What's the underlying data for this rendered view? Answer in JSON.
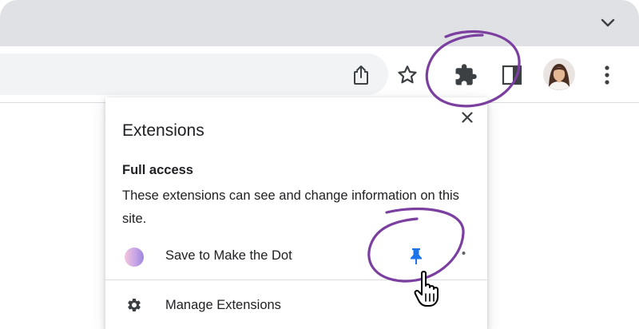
{
  "colors": {
    "tabstrip": "#dfe1e5",
    "text": "#202124",
    "icon": "#5f6368",
    "pin": "#1a73e8",
    "annotation": "#7b3fa0"
  },
  "tabstrip": {
    "menu_icon": "chevron-down-icon"
  },
  "toolbar": {
    "icons": [
      "share-icon",
      "star-icon",
      "puzzle-icon",
      "side-panel-icon",
      "kebab-menu-icon"
    ]
  },
  "popup": {
    "title": "Extensions",
    "section_heading": "Full access",
    "section_description": "These extensions can see and change information on this site.",
    "extensions": [
      {
        "name": "Save to Make the Dot",
        "pinned": true
      }
    ],
    "manage_label": "Manage Extensions"
  }
}
